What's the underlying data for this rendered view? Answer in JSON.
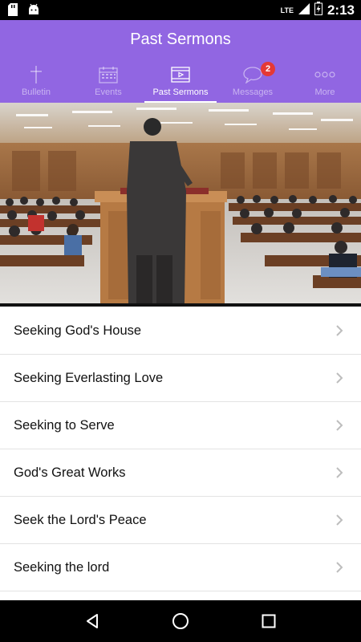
{
  "status_bar": {
    "network": "LTE",
    "time": "2:13"
  },
  "header": {
    "title": "Past Sermons"
  },
  "tabs": [
    {
      "label": "Bulletin",
      "icon": "cross-icon",
      "active": false
    },
    {
      "label": "Events",
      "icon": "calendar-icon",
      "active": false
    },
    {
      "label": "Past Sermons",
      "icon": "video-icon",
      "active": true
    },
    {
      "label": "Messages",
      "icon": "chat-bubble-icon",
      "active": false,
      "badge": "2"
    },
    {
      "label": "More",
      "icon": "more-dots-icon",
      "active": false
    }
  ],
  "hero": {
    "description_icon": "church-sermon-photo"
  },
  "sermons": [
    {
      "title": "Seeking God's House"
    },
    {
      "title": "Seeking Everlasting Love"
    },
    {
      "title": "Seeking to Serve"
    },
    {
      "title": "God's Great Works"
    },
    {
      "title": "Seek the Lord's Peace"
    },
    {
      "title": "Seeking the lord"
    }
  ],
  "colors": {
    "header": "#9166e2",
    "badge": "#e53935"
  }
}
